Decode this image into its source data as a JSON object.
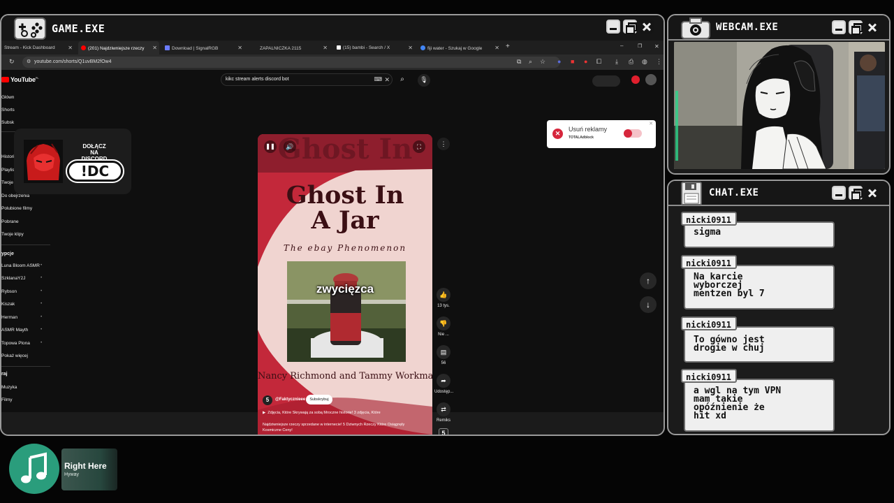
{
  "game": {
    "title": "GAME.EXE",
    "tabs": [
      {
        "label": "Stream - Kick Dashboard",
        "active": false
      },
      {
        "label": "(201) Najdziwniejsze rzeczy",
        "active": true
      },
      {
        "label": "Download | SignalRGB",
        "active": false
      },
      {
        "label": "ZAPALNICZKA 2115",
        "active": false
      },
      {
        "label": "(15) bambi - Search / X",
        "active": false
      },
      {
        "label": "fiji water - Szukaj w Google",
        "active": false
      }
    ],
    "url": "youtube.com/shorts/Q1uvBM2fOw4",
    "youtube": {
      "logo": "YouTube",
      "logo_region": "PL",
      "search_query": "kikc stream alerts discord bot",
      "sidebar_top": [
        "Główn",
        "Shorts",
        "Subsk"
      ],
      "sidebar_you": [
        "Historia",
        "Playlisty",
        "Twoje filmy",
        "Do obejrzenia",
        "Polubione filmy",
        "Pobrane",
        "Twoje klipy"
      ],
      "subs_header": "ypcje",
      "subscriptions": [
        "Luna Bloom ASMR",
        "SzklanaY2J",
        "Rybson",
        "Kiszak",
        "Herman",
        "ASMR Mayth",
        "Topowa Plona",
        "Pokaż więcej"
      ],
      "explore_header": "raj",
      "explore": [
        "Muzyka",
        "Filmy"
      ],
      "discord_overlay": {
        "line1": "DOŁĄCZ",
        "line2": "NA",
        "line3": "DISCORD",
        "tag": "!DC"
      },
      "adblock": {
        "text": "Usuń reklamy",
        "brand": "TOTALAdblock"
      },
      "short": {
        "bg_title": "Ghost In",
        "title_line1": "Ghost In",
        "title_line2": "A Jar",
        "subtitle": "The ebay Phenomenon",
        "caption": "zwycięzca",
        "authors": "Nancy Richmond and Tammy Workman",
        "channel": "@Faktycznieee",
        "subscribe": "Subskrybuj",
        "channel_badge": "5",
        "playlist": "Zdjęcia, Które Skrywają za sobą Mroczne historie! 3 zdjęcia, Które",
        "description": "Najdziwniejsze rzeczy sprzedane w internecie! 5 Dziwnych Rzeczy Które Osiągnęły Kosmiczne Ceny!"
      },
      "actions": [
        {
          "icon": "thumbs-up-icon",
          "label": "13 tys."
        },
        {
          "icon": "thumbs-down-icon",
          "label": "Nie ..."
        },
        {
          "icon": "comment-icon",
          "label": "56"
        },
        {
          "icon": "share-icon",
          "label": "Udostęp..."
        },
        {
          "icon": "remix-icon",
          "label": "Remiks"
        }
      ]
    }
  },
  "webcam": {
    "title": "WEBCAM.EXE"
  },
  "chat": {
    "title": "CHAT.EXE",
    "messages": [
      {
        "user": "nicki0911",
        "text": "sigma"
      },
      {
        "user": "nicki0911",
        "text": "Na karcie\nwyborczej\nmentzen byl 7"
      },
      {
        "user": "nicki0911",
        "text": "To gówno jest\ndrogie w chuj"
      },
      {
        "user": "nicki0911",
        "text": "a wgl na tym VPN\nmam takie\nopóźnienie że\nhit xd"
      }
    ]
  },
  "music": {
    "title": "Right Here",
    "artist": "Hyway"
  },
  "colors": {
    "accent": "#2a9d7c",
    "yt_red": "#ff0000",
    "short_bg": "#c3283a"
  }
}
